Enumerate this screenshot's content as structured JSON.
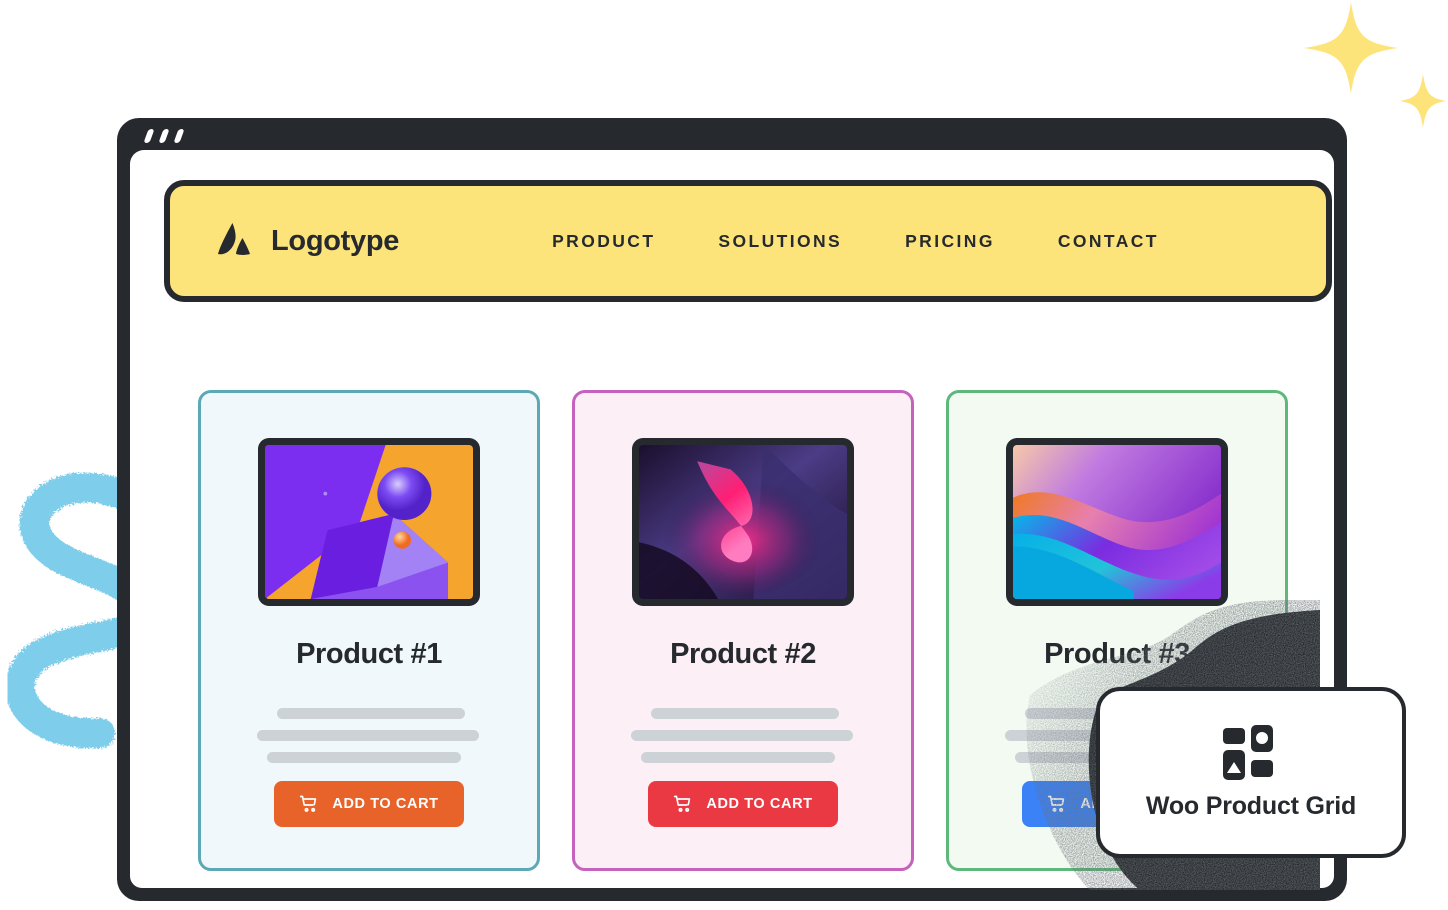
{
  "window": {
    "frame_color": "#262a2e",
    "dots_count": 3
  },
  "header": {
    "brand_name": "Logotype",
    "logo_icon": "mountain-a-logo",
    "background_color": "#fde47a",
    "border_color": "#262a2e",
    "nav": [
      {
        "label": "PRODUCT",
        "name": "nav-link-product"
      },
      {
        "label": "SOLUTIONS",
        "name": "nav-link-solutions"
      },
      {
        "label": "PRICING",
        "name": "nav-link-pricing"
      },
      {
        "label": "CONTACT",
        "name": "nav-link-contact"
      }
    ]
  },
  "products": [
    {
      "title": "Product #1",
      "button_label": "ADD TO CART",
      "button_color": "#e8632a",
      "border_color": "#5ca9b5",
      "background_color": "#f0f8fc",
      "thumbnail": "purple-orange-sphere-cube-render",
      "cart_icon": "shopping-cart-icon"
    },
    {
      "title": "Product #2",
      "button_label": "ADD TO CART",
      "button_color": "#ea3943",
      "border_color": "#c462be",
      "background_color": "#fcf0f6",
      "thumbnail": "dark-pink-magenta-swirl-wallpaper",
      "cart_icon": "shopping-cart-icon"
    },
    {
      "title": "Product #3",
      "button_label": "ADD TO CART",
      "button_color": "#3b82f6",
      "border_color": "#5eb87c",
      "background_color": "#f2faf2",
      "thumbnail": "blue-purple-orange-wave-wallpaper",
      "cart_icon": "shopping-cart-icon"
    }
  ],
  "badge": {
    "label": "Woo Product Grid",
    "icon": "grid-blocks-icon",
    "border_color": "#262a2e"
  },
  "decorations": {
    "sparkle_color": "#fde47a",
    "squiggle_color": "#7ecdea",
    "dust_color": "#262a2e"
  }
}
